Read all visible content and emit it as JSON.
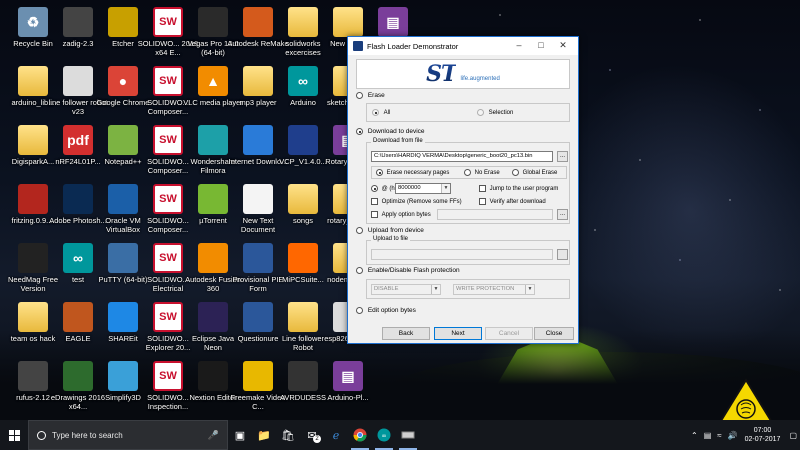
{
  "desktop": {
    "icons": [
      {
        "label": "Recycle Bin",
        "icon": "recycle-bin-icon"
      },
      {
        "label": "zadig-2.3",
        "icon": "zadig-icon"
      },
      {
        "label": "Etcher",
        "icon": "etcher-icon"
      },
      {
        "label": "SOLIDWO... 2016 x64 E...",
        "icon": "solidworks-icon"
      },
      {
        "label": "Vegas Pro 13.0 (64-bit)",
        "icon": "vegas-icon"
      },
      {
        "label": "Autodesk ReMake",
        "icon": "autodesk-icon"
      },
      {
        "label": "solidworks excercises",
        "icon": "folder-icon"
      },
      {
        "label": "New folder",
        "icon": "folder-icon"
      },
      {
        "label": "",
        "icon": "winrar-icon"
      },
      {
        "label": "arduino_lib...",
        "icon": "folder-icon"
      },
      {
        "label": "line follower robot v23",
        "icon": "file-icon"
      },
      {
        "label": "Google Chrome",
        "icon": "chrome-icon"
      },
      {
        "label": "SOLIDWO... Composer...",
        "icon": "solidworks-composer-icon"
      },
      {
        "label": "VLC media player",
        "icon": "vlc-icon"
      },
      {
        "label": "mp3 player",
        "icon": "folder-icon"
      },
      {
        "label": "Arduino",
        "icon": "arduino-icon"
      },
      {
        "label": "sketch_jun...",
        "icon": "folder-icon"
      },
      {
        "label": "DigisparkA...",
        "icon": "folder-icon"
      },
      {
        "label": "nRF24L01P...",
        "icon": "pdf-icon"
      },
      {
        "label": "Notepad++",
        "icon": "notepad-icon"
      },
      {
        "label": "SOLIDWO... Composer...",
        "icon": "solidworks-composer-icon"
      },
      {
        "label": "Wondershare Filmora",
        "icon": "filmora-icon"
      },
      {
        "label": "Internet Downlo...",
        "icon": "idm-icon"
      },
      {
        "label": "VCP_V1.4.0...",
        "icon": "vcp-icon"
      },
      {
        "label": "Rotary-mea...",
        "icon": "winrar-icon"
      },
      {
        "label": "fritzing.0.9....",
        "icon": "fritzing-icon"
      },
      {
        "label": "Adobe Photosh...",
        "icon": "photoshop-icon"
      },
      {
        "label": "Oracle VM VirtualBox",
        "icon": "virtualbox-icon"
      },
      {
        "label": "SOLIDWO... Composer...",
        "icon": "solidworks-composer-icon"
      },
      {
        "label": "µTorrent",
        "icon": "utorrent-icon"
      },
      {
        "label": "New Text Document",
        "icon": "text-document-icon"
      },
      {
        "label": "songs",
        "icon": "folder-icon"
      },
      {
        "label": "rotary_enc...",
        "icon": "folder-icon"
      },
      {
        "label": "NeedMag Free Version",
        "icon": "needmag-icon"
      },
      {
        "label": "test",
        "icon": "arduino-icon"
      },
      {
        "label": "PuTTY (64-bit)",
        "icon": "putty-icon"
      },
      {
        "label": "SOLIDWO... Electrical",
        "icon": "solidworks-electrical-icon"
      },
      {
        "label": "Autodesk Fusion 360",
        "icon": "fusion-icon"
      },
      {
        "label": "Provisional PIE Form",
        "icon": "word-icon"
      },
      {
        "label": "MiPCSuite...",
        "icon": "mi-icon"
      },
      {
        "label": "nodemcu-f...",
        "icon": "folder-icon"
      },
      {
        "label": "team os hack",
        "icon": "folder-icon"
      },
      {
        "label": "EAGLE",
        "icon": "eagle-icon"
      },
      {
        "label": "SHAREit",
        "icon": "shareit-icon"
      },
      {
        "label": "SOLIDWO... Explorer 20...",
        "icon": "solidworks-explorer-icon"
      },
      {
        "label": "Eclipse Java Neon",
        "icon": "eclipse-icon"
      },
      {
        "label": "Questionure",
        "icon": "word-icon"
      },
      {
        "label": "Line follower Robot",
        "icon": "folder-icon"
      },
      {
        "label": "esp8266_de...",
        "icon": "file-icon"
      },
      {
        "label": "rufus-2.12",
        "icon": "rufus-icon"
      },
      {
        "label": "eDrawings 2016 x64...",
        "icon": "edrawings-icon"
      },
      {
        "label": "Simplify3D",
        "icon": "simplify3d-icon"
      },
      {
        "label": "SOLIDWO... Inspection...",
        "icon": "solidworks-inspection-icon"
      },
      {
        "label": "Nextion Editor",
        "icon": "nextion-icon"
      },
      {
        "label": "Freemake Video C...",
        "icon": "freemake-icon"
      },
      {
        "label": "AVRDUDESS",
        "icon": "avrdudess-icon"
      },
      {
        "label": "Arduino-Pl...",
        "icon": "winrar-icon"
      }
    ]
  },
  "dialog": {
    "title": "Flash Loader Demonstrator",
    "logo_text": "ST",
    "tagline": "life.augmented",
    "erase": {
      "label": "Erase",
      "all": "All",
      "selection": "Selection"
    },
    "download": {
      "label": "Download to device",
      "group_label": "Download from file",
      "file_path": "C:\\Users\\HARDIQ VERMA\\Desktop\\generic_boot20_pc13.bin",
      "browse": "...",
      "erase_necessary": "Erase necessary pages",
      "no_erase": "No Erase",
      "global_erase": "Global Erase",
      "address_prefix": "@ (h)",
      "address": "8000000",
      "jump": "Jump to the user program",
      "optimize": "Optimize (Remove some FFs)",
      "verify": "Verify after download",
      "apply_option": "Apply option bytes"
    },
    "upload": {
      "label": "Upload from device",
      "group_label": "Upload to file"
    },
    "protection": {
      "label": "Enable/Disable Flash protection",
      "mode": "DISABLE",
      "type": "WRITE PROTECTION"
    },
    "edit_option": {
      "label": "Edit option bytes"
    },
    "buttons": {
      "back": "Back",
      "next": "Next",
      "cancel": "Cancel",
      "close": "Close"
    }
  },
  "taskbar": {
    "search_placeholder": "Type here to search",
    "mail_badge": "2",
    "time": "07:00",
    "date": "02-07-2017"
  }
}
